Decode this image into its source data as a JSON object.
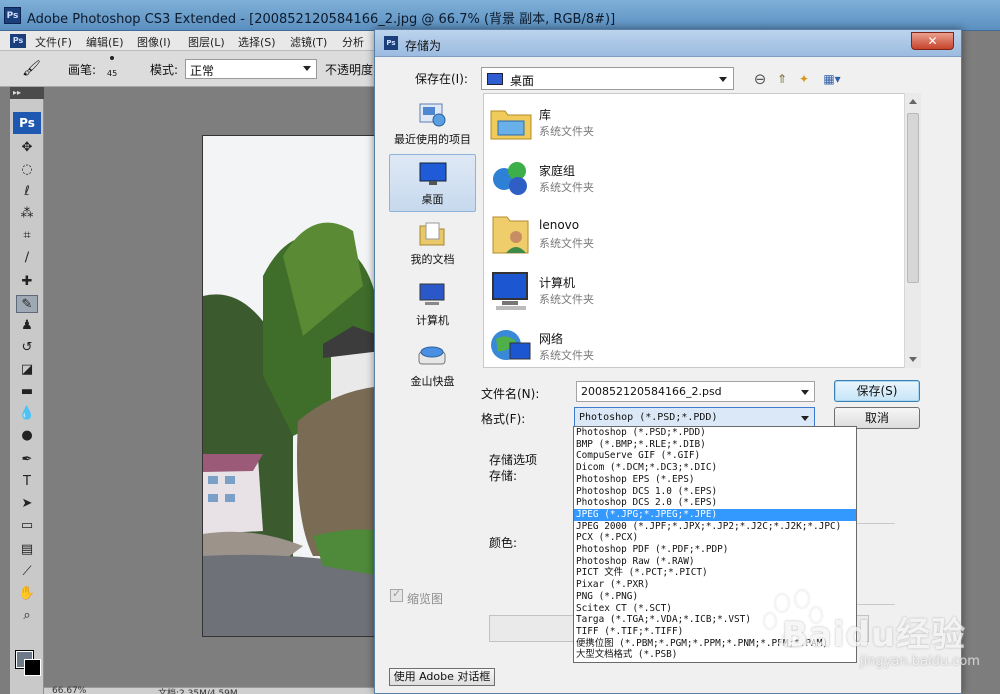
{
  "photoshop": {
    "logo": "Ps",
    "title": "Adobe Photoshop CS3 Extended - [200852120584166_2.jpg @ 66.7% (背景 副本, RGB/8#)]",
    "menu": [
      "文件(F)",
      "编辑(E)",
      "图像(I)",
      "图层(L)",
      "选择(S)",
      "滤镜(T)",
      "分析"
    ],
    "options": {
      "brush_label": "画笔:",
      "brush_size": "45",
      "mode_label": "模式:",
      "mode_value": "正常",
      "opacity_label": "不透明度"
    },
    "toolbox_logo": "Ps",
    "status": {
      "zoom": "66.67%",
      "doc": "文档:2.35M/4.59M"
    }
  },
  "dialog": {
    "logo": "Ps",
    "title": "存储为",
    "close": "✕",
    "save_in_label": "保存在(I):",
    "save_in_value": "桌面",
    "places": [
      {
        "label": "最近使用的项目",
        "icon": "recent-places-icon"
      },
      {
        "label": "桌面",
        "icon": "desktop-icon"
      },
      {
        "label": "我的文档",
        "icon": "documents-folder-icon"
      },
      {
        "label": "计算机",
        "icon": "computer-icon"
      },
      {
        "label": "金山快盘",
        "icon": "drive-icon"
      }
    ],
    "files": [
      {
        "name": "库",
        "type": "系统文件夹",
        "icon": "libraries-icon"
      },
      {
        "name": "家庭组",
        "type": "系统文件夹",
        "icon": "homegroup-icon"
      },
      {
        "name": "lenovo",
        "type": "系统文件夹",
        "icon": "user-folder-icon"
      },
      {
        "name": "计算机",
        "type": "系统文件夹",
        "icon": "computer-icon"
      },
      {
        "name": "网络",
        "type": "系统文件夹",
        "icon": "network-icon"
      }
    ],
    "filename_label": "文件名(N):",
    "filename_value": "200852120584166_2.psd",
    "format_label": "格式(F):",
    "format_value": "Photoshop (*.PSD;*.PDD)",
    "save_button": "保存(S)",
    "cancel_button": "取消",
    "options_title": "存储选项",
    "store_label": "存储:",
    "color_label": "颜色:",
    "thumbnail_label": "缩览图",
    "adobe_dialog_button": "使用 Adobe 对话框"
  },
  "format_options": [
    "Photoshop (*.PSD;*.PDD)",
    "BMP (*.BMP;*.RLE;*.DIB)",
    "CompuServe GIF (*.GIF)",
    "Dicom (*.DCM;*.DC3;*.DIC)",
    "Photoshop EPS (*.EPS)",
    "Photoshop DCS 1.0 (*.EPS)",
    "Photoshop DCS 2.0 (*.EPS)",
    "JPEG (*.JPG;*.JPEG;*.JPE)",
    "JPEG 2000 (*.JPF;*.JPX;*.JP2;*.J2C;*.J2K;*.JPC)",
    "PCX (*.PCX)",
    "Photoshop PDF (*.PDF;*.PDP)",
    "Photoshop Raw (*.RAW)",
    "PICT 文件 (*.PCT;*.PICT)",
    "Pixar (*.PXR)",
    "PNG (*.PNG)",
    "Scitex CT (*.SCT)",
    "Targa (*.TGA;*.VDA;*.ICB;*.VST)",
    "TIFF (*.TIF;*.TIFF)",
    "便携位图 (*.PBM;*.PGM;*.PPM;*.PNM;*.PFM;*.PAM)",
    "大型文档格式 (*.PSB)"
  ],
  "selected_format_index": 7,
  "watermark": {
    "brand": "Baidu经验",
    "site": "jingyan.baidu.com"
  }
}
